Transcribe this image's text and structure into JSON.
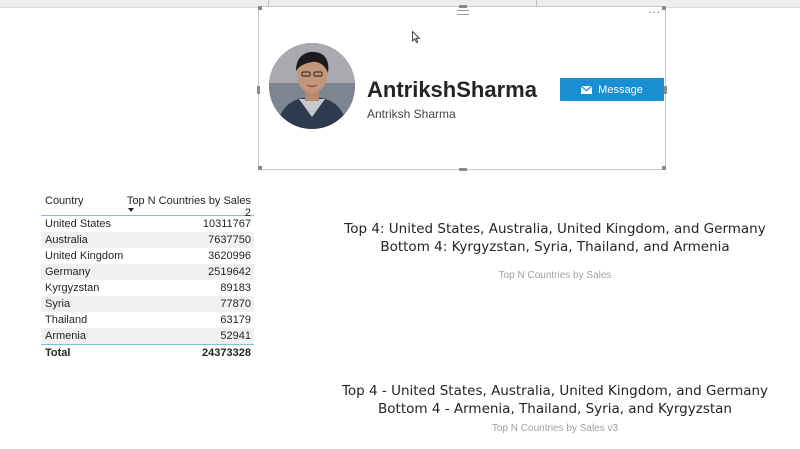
{
  "profile": {
    "name": "AntrikshSharma",
    "subtitle": "Antriksh Sharma",
    "message_button": "Message",
    "more_options": "···",
    "button_color": "#1a8ed1"
  },
  "table": {
    "columns": [
      "Country",
      "Top N Countries by Sales 2"
    ],
    "rows": [
      {
        "country": "United States",
        "value": "10311767"
      },
      {
        "country": "Australia",
        "value": "7637750"
      },
      {
        "country": "United Kingdom",
        "value": "3620996"
      },
      {
        "country": "Germany",
        "value": "2519642"
      },
      {
        "country": "Kyrgyzstan",
        "value": "89183"
      },
      {
        "country": "Syria",
        "value": "77870"
      },
      {
        "country": "Thailand",
        "value": "63179"
      },
      {
        "country": "Armenia",
        "value": "52941"
      }
    ],
    "total_label": "Total",
    "total_value": "24373328"
  },
  "card1": {
    "line1": "Top 4: United States, Australia, United Kingdom, and Germany",
    "line2": "Bottom 4: Kyrgyzstan, Syria, Thailand, and Armenia",
    "caption": "Top N Countries by Sales"
  },
  "card2": {
    "line1": "Top 4 - United States, Australia, United Kingdom, and Germany",
    "line2": "Bottom 4 - Armenia, Thailand, Syria, and Kyrgyzstan",
    "caption": "Top N Countries by Sales v3"
  }
}
